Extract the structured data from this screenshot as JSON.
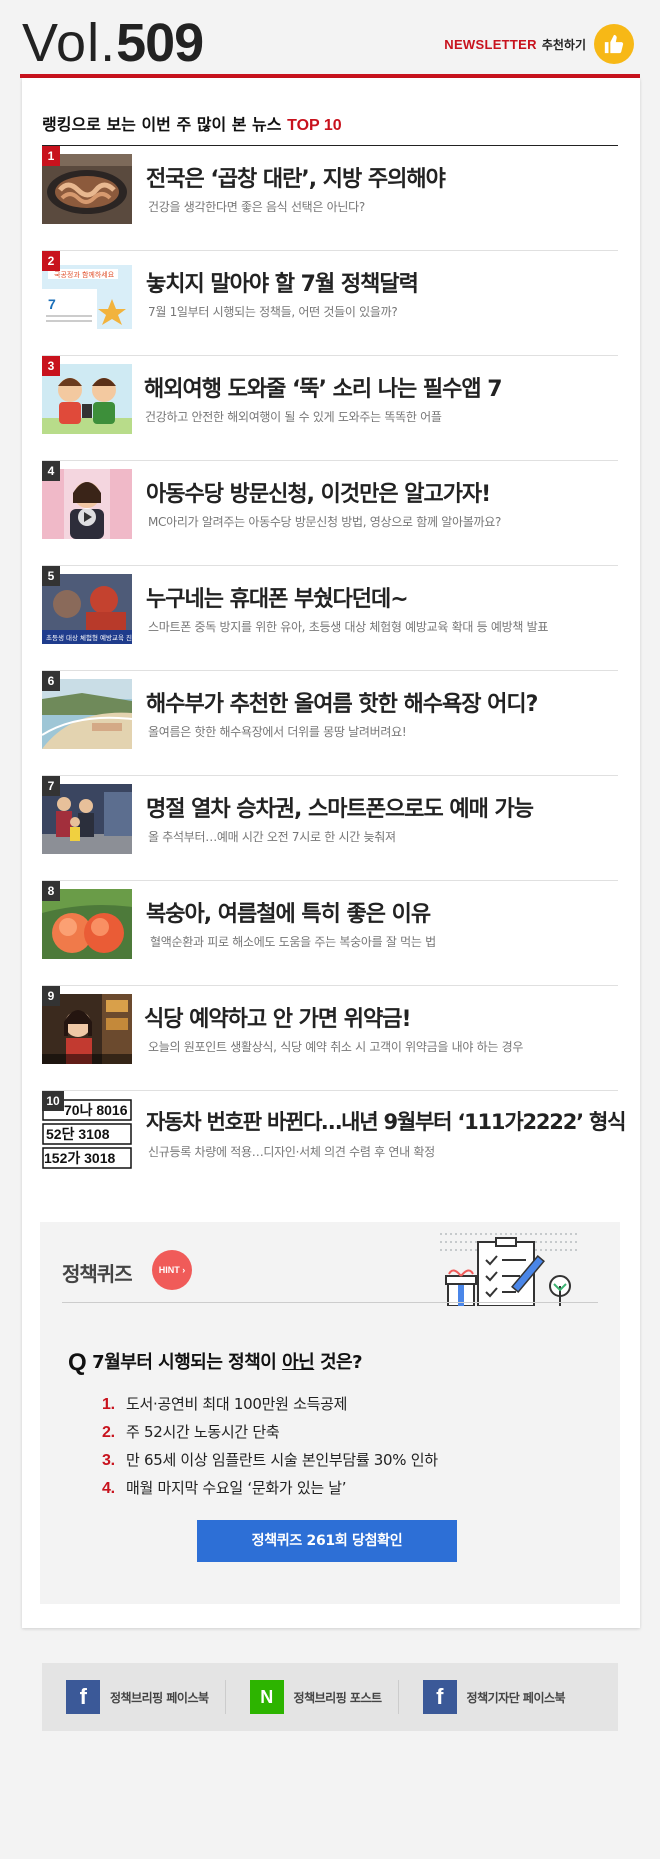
{
  "header": {
    "vol_label": "Vol.",
    "vol_number": "509",
    "newsletter": "NEWSLETTER",
    "recommend": "추천하기"
  },
  "ranking": {
    "title_prefix": "랭킹으로 보는 이번 주 많이 본 뉴스 ",
    "title_top": "TOP 10",
    "items": [
      {
        "rank": "1",
        "title": "전국은 ‘곱창 대란’, 지방 주의해야",
        "sub": "건강을 생각한다면 좋은 음식 선택은 아닌다?"
      },
      {
        "rank": "2",
        "title": "놓치지 말아야 할 7월 정책달력",
        "sub": "7월 1일부터 시행되는 정책들, 어떤 것들이 있을까?"
      },
      {
        "rank": "3",
        "title": "해외여행 도와줄 ‘뚝’ 소리 나는 필수앱 7",
        "sub": "건강하고 안전한 해외여행이 될 수 있게 도와주는 똑똑한 어플"
      },
      {
        "rank": "4",
        "title": "아동수당 방문신청, 이것만은 알고가자!",
        "sub": "MC아리가 알려주는 아동수당 방문신청 방법, 영상으로 함께 알아볼까요?"
      },
      {
        "rank": "5",
        "title": "누구네는 휴대폰 부쉈다던데~",
        "sub": "스마트폰 중독 방지를 위한 유아, 초등생 대상 체험형 예방교육 확대 등 예방책 발표"
      },
      {
        "rank": "6",
        "title": "해수부가 추천한 올여름 핫한 해수욕장 어디?",
        "sub": "올여름은 핫한 해수욕장에서 더위를 몽땅 날려버려요!"
      },
      {
        "rank": "7",
        "title": "명절 열차 승차권, 스마트폰으로도 예매 가능",
        "sub": "올 추석부터…예매 시간 오전 7시로 한 시간 늦춰져"
      },
      {
        "rank": "8",
        "title": "복숭아, 여름철에 특히 좋은 이유",
        "sub": "혈액순환과 피로 해소에도 도움을 주는 복숭아를 잘 먹는 법"
      },
      {
        "rank": "9",
        "title": "식당 예약하고 안 가면 위약금!",
        "sub": "오늘의 원포인트 생활상식, 식당 예약 취소 시 고객이 위약금을 내야 하는 경우"
      },
      {
        "rank": "10",
        "title": "자동차 번호판 바뀐다…내년 9월부터 ‘111가2222’ 형식",
        "sub": "신규등록 차량에 적용…디자인·서체 의견 수렴 후 연내 확정"
      }
    ],
    "thumb_texts": {
      "t2_banner": "국공정과 함께하세요",
      "t2_july": "7",
      "t5_caption": "초등생 대상 체험형 예방교육 진행",
      "t10_plate1": "70나 8016",
      "t10_plate2": "52단 3108",
      "t10_plate3": "152가 3018"
    }
  },
  "quiz": {
    "title": "정책퀴즈",
    "hint": "HINT",
    "q_mark": "Q",
    "question_pre": "7월부터 시행되는 정책이 ",
    "question_u": "아닌",
    "question_post": " 것은?",
    "options": [
      {
        "n": "1.",
        "text": "도서·공연비 최대 100만원 소득공제"
      },
      {
        "n": "2.",
        "text": "주 52시간 노동시간 단축"
      },
      {
        "n": "3.",
        "text": "만 65세 이상 임플란트 시술 본인부담률 30% 인하"
      },
      {
        "n": "4.",
        "text": "매월 마지막 수요일 ‘문화가 있는 날’"
      }
    ],
    "cta": "정책퀴즈 261회 당첨확인"
  },
  "footer": {
    "links": [
      {
        "icon": "f",
        "label": "정책브리핑 페이스북"
      },
      {
        "icon": "N",
        "label": "정책브리핑 포스트"
      },
      {
        "icon": "f",
        "label": "정책기자단 페이스북"
      }
    ]
  },
  "colors": {
    "accent": "#c8121d",
    "cta": "#2d6fd6",
    "hint": "#f05b59",
    "facebook": "#3b5998",
    "naver": "#2db400"
  }
}
